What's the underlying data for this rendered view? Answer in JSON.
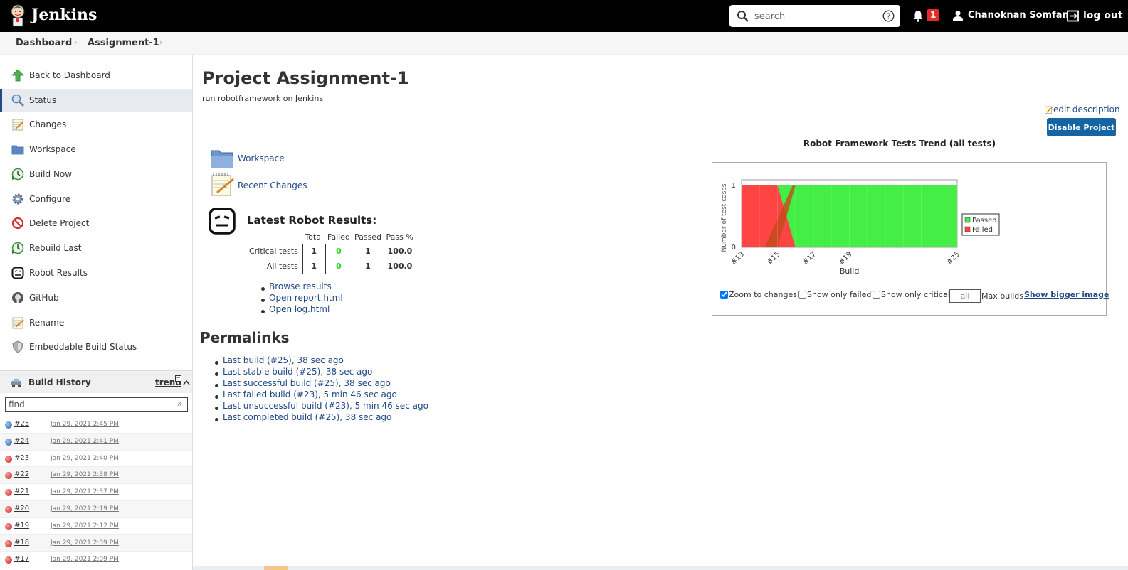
{
  "header": {
    "brand": "Jenkins",
    "search_placeholder": "search",
    "notification_count": "1",
    "user_name": "Chanoknan Somfan",
    "logout_label": "log out"
  },
  "breadcrumb": [
    "Dashboard",
    "Assignment-1"
  ],
  "sidebar": {
    "active_index": 1,
    "tasks": [
      {
        "label": "Back to Dashboard",
        "icon": "up-arrow-icon"
      },
      {
        "label": "Status",
        "icon": "magnifier-icon"
      },
      {
        "label": "Changes",
        "icon": "notepad-icon"
      },
      {
        "label": "Workspace",
        "icon": "folder-icon"
      },
      {
        "label": "Build Now",
        "icon": "clock-play-icon"
      },
      {
        "label": "Configure",
        "icon": "gear-icon"
      },
      {
        "label": "Delete Project",
        "icon": "no-entry-icon"
      },
      {
        "label": "Rebuild Last",
        "icon": "clock-play-icon"
      },
      {
        "label": "Robot Results",
        "icon": "robot-icon"
      },
      {
        "label": "GitHub",
        "icon": "github-icon"
      },
      {
        "label": "Rename",
        "icon": "notepad-icon"
      },
      {
        "label": "Embeddable Build Status",
        "icon": "shield-icon"
      }
    ]
  },
  "build_history": {
    "title": "Build History",
    "trend_label": "trend",
    "find_placeholder": "find",
    "clear_label": "x",
    "builds": [
      {
        "number": "#25",
        "date": "Jan 29, 2021 2:45 PM",
        "status": "success"
      },
      {
        "number": "#24",
        "date": "Jan 29, 2021 2:41 PM",
        "status": "success"
      },
      {
        "number": "#23",
        "date": "Jan 29, 2021 2:40 PM",
        "status": "failed"
      },
      {
        "number": "#22",
        "date": "Jan 29, 2021 2:38 PM",
        "status": "failed"
      },
      {
        "number": "#21",
        "date": "Jan 29, 2021 2:37 PM",
        "status": "failed"
      },
      {
        "number": "#20",
        "date": "Jan 29, 2021 2:19 PM",
        "status": "failed"
      },
      {
        "number": "#19",
        "date": "Jan 29, 2021 2:12 PM",
        "status": "failed"
      },
      {
        "number": "#18",
        "date": "Jan 29, 2021 2:09 PM",
        "status": "failed"
      },
      {
        "number": "#17",
        "date": "Jan 29, 2021 2:09 PM",
        "status": "failed"
      }
    ]
  },
  "main": {
    "title": "Project Assignment-1",
    "description": "run robotframework on Jenkins",
    "edit_description": "edit description",
    "disable_button": "Disable Project",
    "actions": [
      {
        "label": "Workspace",
        "icon": "folder-icon"
      },
      {
        "label": "Recent Changes",
        "icon": "notepad-icon"
      }
    ],
    "robot": {
      "title": "Latest Robot Results:",
      "columns": [
        "Total",
        "Failed",
        "Passed",
        "Pass %"
      ],
      "rows": [
        {
          "label": "Critical tests",
          "total": "1",
          "failed": "0",
          "passed": "1",
          "pass_pct": "100.0"
        },
        {
          "label": "All tests",
          "total": "1",
          "failed": "0",
          "passed": "1",
          "pass_pct": "100.0"
        }
      ],
      "links": [
        "Browse results",
        "Open report.html",
        "Open log.html"
      ]
    },
    "permalinks_title": "Permalinks",
    "permalinks": [
      "Last build (#25), 38 sec ago",
      "Last stable build (#25), 38 sec ago",
      "Last successful build (#25), 38 sec ago",
      "Last failed build (#23), 5 min 46 sec ago",
      "Last unsuccessful build (#23), 5 min 46 sec ago",
      "Last completed build (#25), 38 sec ago"
    ]
  },
  "trend": {
    "title": "Robot Framework Tests Trend (all tests)",
    "zoom_label": "Zoom to changes",
    "zoom_checked": true,
    "only_failed_label": "Show only failed",
    "only_critical_label": "Show only critical",
    "max_builds_value": "all",
    "max_builds_label": "Max builds",
    "bigger_image": "Show bigger image"
  },
  "chart_data": {
    "type": "area",
    "title": "",
    "xlabel": "Build",
    "ylabel": "Number of test cases",
    "x": [
      "#13",
      "#14",
      "#15",
      "#16",
      "#17",
      "#18",
      "#19",
      "#20",
      "#21",
      "#22",
      "#23",
      "#24",
      "#25"
    ],
    "x_tick_labels": [
      "#13",
      "#15",
      "#17",
      "#19",
      "#25"
    ],
    "ylim": [
      0,
      1
    ],
    "y_ticks": [
      0,
      1
    ],
    "series": [
      {
        "name": "Passed",
        "color": "#44ee44",
        "values": [
          0,
          0,
          0,
          1,
          1,
          1,
          1,
          1,
          1,
          1,
          1,
          1,
          1
        ]
      },
      {
        "name": "Failed",
        "color": "#ff4444",
        "values": [
          1,
          1,
          1,
          0,
          0,
          0,
          0,
          0,
          0,
          0,
          0,
          0,
          0
        ]
      }
    ],
    "legend_position": "right"
  }
}
